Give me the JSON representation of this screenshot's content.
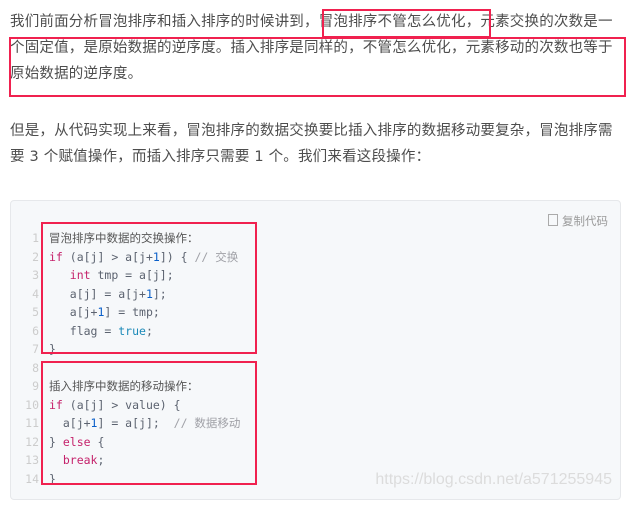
{
  "paragraphs": [
    "我们前面分析冒泡排序和插入排序的时候讲到，冒泡排序不管怎么优化，元素交换的次数是一个固定值，是原始数据的逆序度。插入排序是同样的，不管怎么优化，元素移动的次数也等于原始数据的逆序度。",
    "但是，从代码实现上来看，冒泡排序的数据交换要比插入排序的数据移动要复杂，冒泡排序需要 3 个赋值操作，而插入排序只需要 1 个。我们来看这段操作："
  ],
  "code_block": {
    "copy_label": "复制代码",
    "copy_icon": "copy-icon",
    "lines": [
      [
        {
          "t": "冒泡排序中数据的交换操作：",
          "c": "tx"
        }
      ],
      [
        {
          "t": "if",
          "c": "kw"
        },
        {
          "t": " (a[j] > a[j+",
          "c": "pl"
        },
        {
          "t": "1",
          "c": "num"
        },
        {
          "t": "]) { ",
          "c": "pl"
        },
        {
          "t": "// 交换",
          "c": "cm"
        }
      ],
      [
        {
          "t": "   ",
          "c": "pl"
        },
        {
          "t": "int",
          "c": "kw"
        },
        {
          "t": " tmp = a[j];",
          "c": "pl"
        }
      ],
      [
        {
          "t": "   a[j] = a[j+",
          "c": "pl"
        },
        {
          "t": "1",
          "c": "num"
        },
        {
          "t": "];",
          "c": "pl"
        }
      ],
      [
        {
          "t": "   a[j+",
          "c": "pl"
        },
        {
          "t": "1",
          "c": "num"
        },
        {
          "t": "] = tmp;",
          "c": "pl"
        }
      ],
      [
        {
          "t": "   flag = ",
          "c": "pl"
        },
        {
          "t": "true",
          "c": "lit"
        },
        {
          "t": ";",
          "c": "pl"
        }
      ],
      [
        {
          "t": "}",
          "c": "pl"
        }
      ],
      [],
      [
        {
          "t": "插入排序中数据的移动操作：",
          "c": "tx"
        }
      ],
      [
        {
          "t": "if",
          "c": "kw"
        },
        {
          "t": " (a[j] > value) {",
          "c": "pl"
        }
      ],
      [
        {
          "t": "  a[j+",
          "c": "pl"
        },
        {
          "t": "1",
          "c": "num"
        },
        {
          "t": "] = a[j];  ",
          "c": "pl"
        },
        {
          "t": "// 数据移动",
          "c": "cm"
        }
      ],
      [
        {
          "t": "} ",
          "c": "pl"
        },
        {
          "t": "else",
          "c": "kw"
        },
        {
          "t": " {",
          "c": "pl"
        }
      ],
      [
        {
          "t": "  ",
          "c": "pl"
        },
        {
          "t": "break",
          "c": "kw"
        },
        {
          "t": ";",
          "c": "pl"
        }
      ],
      [
        {
          "t": "}",
          "c": "pl"
        }
      ]
    ]
  },
  "watermark": "https://blog.csdn.net/a571255945",
  "colors": {
    "highlight": "#f0214f",
    "keyword": "#c5226b",
    "number": "#0a5fc9"
  }
}
